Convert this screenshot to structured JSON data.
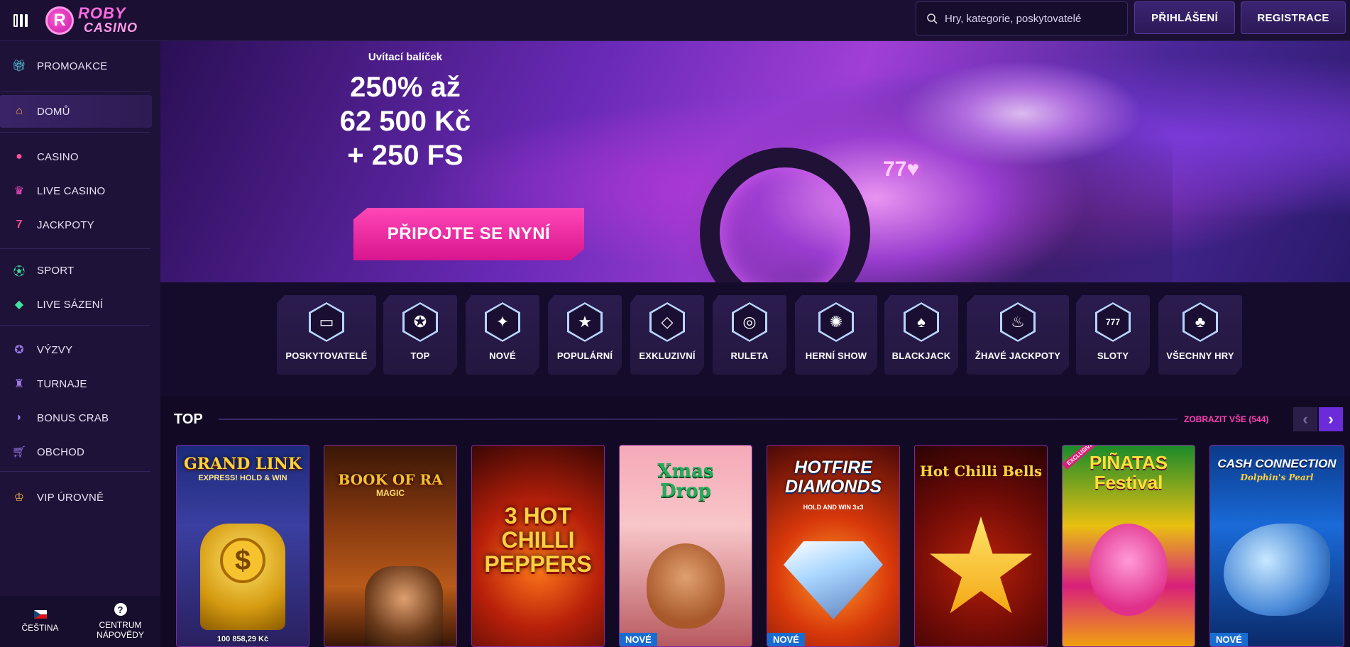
{
  "brand": {
    "line1": "ROBY",
    "line2": "CASINO",
    "badge": "R"
  },
  "search": {
    "placeholder": "Hry, kategorie, poskytovatelé"
  },
  "header": {
    "login": "PŘIHLÁŠENÍ",
    "register": "REGISTRACE"
  },
  "sidebar": {
    "items": [
      {
        "label": "PROMOAKCE",
        "icon": "gift-icon"
      },
      {
        "label": "DOMŮ",
        "icon": "home-icon"
      },
      {
        "label": "CASINO",
        "icon": "chip-icon"
      },
      {
        "label": "LIVE CASINO",
        "icon": "dealer-icon"
      },
      {
        "label": "JACKPOTY",
        "icon": "seven-icon"
      },
      {
        "label": "SPORT",
        "icon": "football-icon"
      },
      {
        "label": "LIVE SÁZENÍ",
        "icon": "ticket-icon"
      },
      {
        "label": "VÝZVY",
        "icon": "medal-icon"
      },
      {
        "label": "TURNAJE",
        "icon": "trophy-icon"
      },
      {
        "label": "BONUS CRAB",
        "icon": "crab-icon"
      },
      {
        "label": "OBCHOD",
        "icon": "cart-icon"
      },
      {
        "label": "VIP ÚROVNĚ",
        "icon": "crown-icon"
      }
    ],
    "language": "ČEŠTINA",
    "help_line1": "CENTRUM",
    "help_line2": "NÁPOVĚDY"
  },
  "hero": {
    "subtitle": "Uvítací balíček",
    "line1": "250% až",
    "line2": "62 500 Kč",
    "line3": "+ 250 FS",
    "cta": "PŘIPOJTE SE NYNÍ",
    "bike_tag": "77♥"
  },
  "categories": [
    {
      "label": "POSKYTOVATELÉ",
      "icon": "folder-icon"
    },
    {
      "label": "TOP",
      "icon": "award-icon"
    },
    {
      "label": "NOVÉ",
      "icon": "sparkle-icon"
    },
    {
      "label": "POPULÁRNÍ",
      "icon": "star-icon"
    },
    {
      "label": "EXKLUZIVNÍ",
      "icon": "diamond-icon"
    },
    {
      "label": "RULETA",
      "icon": "roulette-icon"
    },
    {
      "label": "HERNÍ SHOW",
      "icon": "wheel-icon"
    },
    {
      "label": "BLACKJACK",
      "icon": "spade-icon"
    },
    {
      "label": "ŽHAVÉ JACKPOTY",
      "icon": "flame-icon"
    },
    {
      "label": "SLOTY",
      "icon": "slot-icon"
    },
    {
      "label": "VŠECHNY HRY",
      "icon": "cherry-icon"
    }
  ],
  "top_section": {
    "title": "TOP",
    "see_all": "ZOBRAZIT VŠE (544)",
    "games": [
      {
        "title": "GRAND LINK",
        "sub": "EXPRESS! HOLD & WIN",
        "amount": "100 858,29 Kč",
        "badge": ""
      },
      {
        "title": "BOOK OF RA",
        "sub": "MAGIC",
        "amount": "",
        "badge": ""
      },
      {
        "title": "3 HOT CHILLI PEPPERS",
        "sub": "",
        "amount": "",
        "badge": ""
      },
      {
        "title": "Xmas Drop",
        "sub": "",
        "amount": "",
        "badge": "NOVÉ"
      },
      {
        "title": "HOTFIRE DIAMONDS",
        "sub": "HOLD AND WIN 3x3",
        "amount": "",
        "badge": "NOVÉ"
      },
      {
        "title": "Hot Chilli Bells",
        "sub": "",
        "amount": "",
        "badge": ""
      },
      {
        "title": "PIÑATAS Festival",
        "sub": "EXCLUSIVE",
        "amount": "",
        "badge": ""
      },
      {
        "title": "CASH CONNECTION",
        "sub": "Dolphin's Pearl",
        "amount": "",
        "badge": "NOVÉ"
      }
    ]
  }
}
